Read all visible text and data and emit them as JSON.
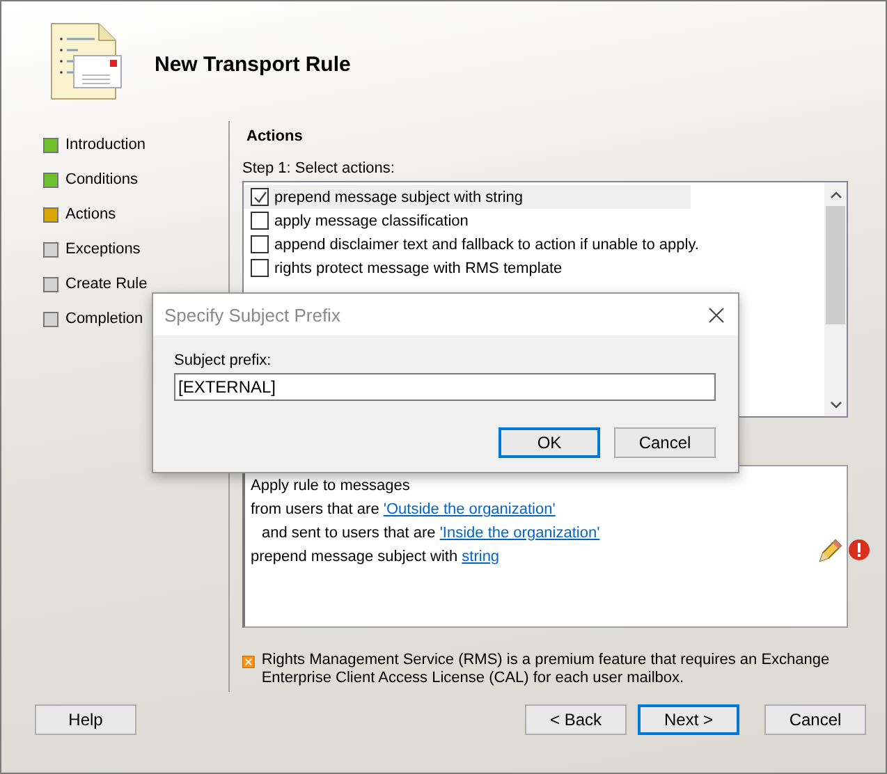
{
  "header": {
    "title": "New Transport Rule"
  },
  "steps": [
    {
      "label": "Introduction",
      "color": "#6ec12a"
    },
    {
      "label": "Conditions",
      "color": "#6ec12a"
    },
    {
      "label": "Actions",
      "color": "#d8a800"
    },
    {
      "label": "Exceptions",
      "color": "#d4d4d4"
    },
    {
      "label": "Create Rule",
      "color": "#d4d4d4"
    },
    {
      "label": "Completion",
      "color": "#d4d4d4"
    }
  ],
  "section_title": "Actions",
  "step_label": "Step 1: Select actions:",
  "actions": [
    {
      "label": "prepend message subject with string",
      "checked": true,
      "selected": true
    },
    {
      "label": "apply message classification",
      "checked": false,
      "selected": false
    },
    {
      "label": "append disclaimer text and fallback to action if unable to apply.",
      "checked": false,
      "selected": false
    },
    {
      "label": "rights protect message with RMS template",
      "checked": false,
      "selected": false
    }
  ],
  "description": [
    {
      "kind": "plain",
      "text": "Apply rule to messages"
    },
    {
      "kind": "plain",
      "text": "from users that are ",
      "link": "'Outside the organization'"
    },
    {
      "kind": "indented",
      "text": "and sent to users that are ",
      "link": "'Inside the organization'"
    },
    {
      "kind": "plain",
      "text": "prepend message subject with ",
      "link": "string"
    }
  ],
  "note": "Rights Management Service (RMS) is a premium feature that requires an Exchange Enterprise Client Access License (CAL) for each user mailbox.",
  "buttons": {
    "help": "Help",
    "back": "< Back",
    "next": "Next >",
    "cancel": "Cancel"
  },
  "dialog": {
    "title": "Specify Subject Prefix",
    "field_label": "Subject prefix:",
    "value": "[EXTERNAL]",
    "ok": "OK",
    "cancel": "Cancel"
  }
}
